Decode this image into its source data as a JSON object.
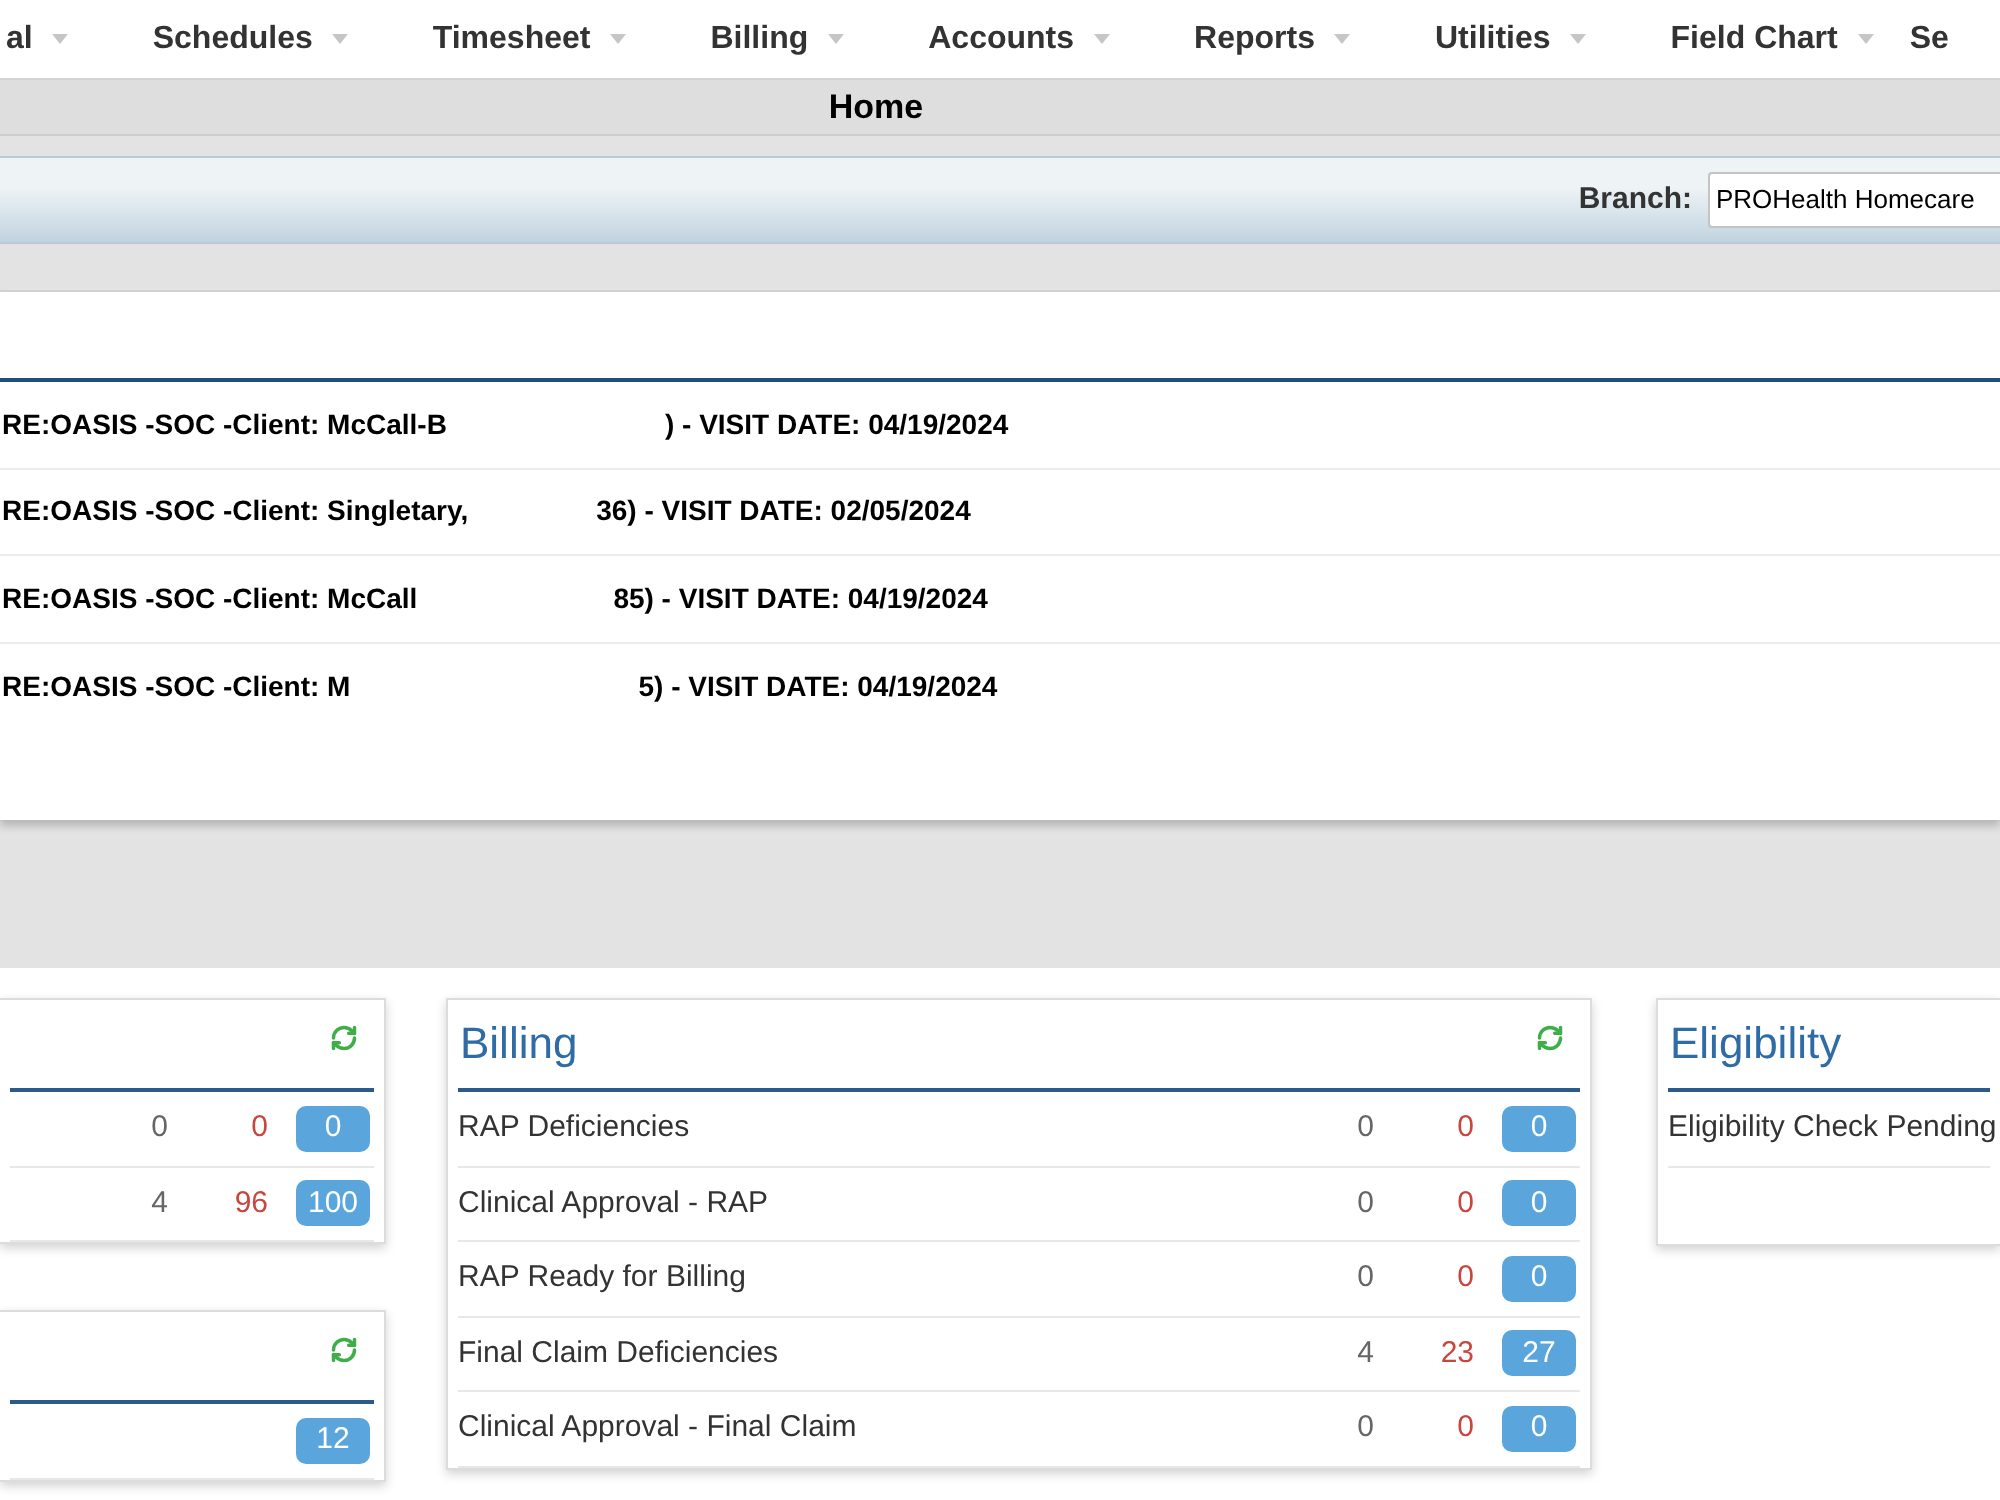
{
  "nav_menu": [
    {
      "label": "al",
      "caret": true
    },
    {
      "label": "Schedules",
      "caret": true
    },
    {
      "label": "Timesheet",
      "caret": true
    },
    {
      "label": "Billing",
      "caret": true
    },
    {
      "label": "Accounts",
      "caret": true
    },
    {
      "label": "Reports",
      "caret": true
    },
    {
      "label": "Utilities",
      "caret": true
    },
    {
      "label": "Field Chart",
      "caret": true
    },
    {
      "label": "Se",
      "caret": false
    }
  ],
  "page_title": "Home",
  "branch_bar": {
    "label": "Branch:",
    "value": "PROHealth Homecare"
  },
  "messages": [
    {
      "text_before": "RE:OASIS -SOC -Client: McCall-B",
      "text_after": ") - VISIT DATE: 04/19/2024"
    },
    {
      "text_before": "RE:OASIS -SOC -Client: Singletary,",
      "text_after": "36) - VISIT DATE: 02/05/2024"
    },
    {
      "text_before": "RE:OASIS -SOC -Client: McCall",
      "text_after": "85) - VISIT DATE: 04/19/2024"
    },
    {
      "text_before": "RE:OASIS -SOC -Client: M",
      "text_after": "5) - VISIT DATE: 04/19/2024"
    }
  ],
  "widgets": {
    "left_column": [
      {
        "refresh": true,
        "rows": [
          {
            "col_1": "0",
            "col_2": "0",
            "total": "0"
          },
          {
            "col_1": "4",
            "col_2": "96",
            "total": "100"
          }
        ]
      },
      {
        "refresh": true,
        "rows": [
          {
            "total": "12"
          }
        ]
      }
    ],
    "billing": {
      "title": "Billing",
      "refresh": true,
      "rows": [
        {
          "label": "RAP Deficiencies",
          "col_1": "0",
          "col_2": "0",
          "total": "0"
        },
        {
          "label": "Clinical Approval - RAP",
          "col_1": "0",
          "col_2": "0",
          "total": "0"
        },
        {
          "label": "RAP Ready for Billing",
          "col_1": "0",
          "col_2": "0",
          "total": "0"
        },
        {
          "label": "Final Claim Deficiencies",
          "col_1": "4",
          "col_2": "23",
          "total": "27"
        },
        {
          "label": "Clinical Approval - Final Claim",
          "col_1": "0",
          "col_2": "0",
          "total": "0"
        }
      ]
    },
    "eligibility": {
      "title": "Eligibility",
      "refresh": false,
      "rows": [
        {
          "label": "Eligibility Check Pending"
        }
      ]
    }
  }
}
